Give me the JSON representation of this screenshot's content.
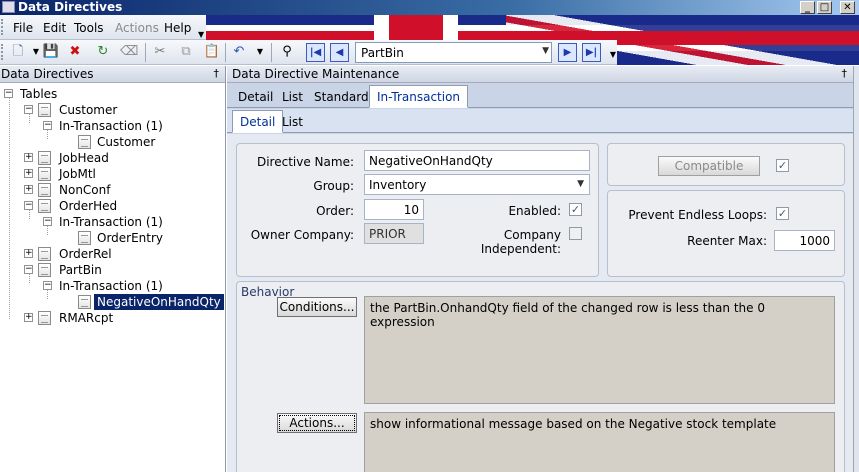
{
  "window": {
    "title": "Data Directives"
  },
  "menu": {
    "items": [
      "File",
      "Edit",
      "Tools",
      "Actions",
      "Help"
    ],
    "disabled": [
      "Actions"
    ]
  },
  "toolbar": {
    "record_combo_value": "PartBin"
  },
  "left_pane": {
    "header": "Data Directives",
    "tree": [
      {
        "label": "Tables"
      },
      {
        "label": "Customer"
      },
      {
        "label": "In-Transaction (1)"
      },
      {
        "label": "Customer"
      },
      {
        "label": "JobHead"
      },
      {
        "label": "JobMtl"
      },
      {
        "label": "NonConf"
      },
      {
        "label": "OrderHed"
      },
      {
        "label": "In-Transaction (1)"
      },
      {
        "label": "OrderEntry"
      },
      {
        "label": "OrderRel"
      },
      {
        "label": "PartBin"
      },
      {
        "label": "In-Transaction (1)"
      },
      {
        "label": "NegativeOnHandQty"
      },
      {
        "label": "RMARcpt"
      }
    ]
  },
  "right_pane": {
    "header": "Data Directive Maintenance",
    "top_tabs": [
      "Detail",
      "List",
      "Standard",
      "In-Transaction"
    ],
    "sub_tabs": [
      "Detail",
      "List"
    ]
  },
  "form": {
    "directive_name": {
      "label": "Directive Name:",
      "value": "NegativeOnHandQty"
    },
    "group": {
      "label": "Group:",
      "value": "Inventory"
    },
    "order": {
      "label": "Order:",
      "value": "10"
    },
    "enabled": {
      "label": "Enabled:",
      "checked": true
    },
    "owner_company": {
      "label": "Owner Company:",
      "value": "PRIOR"
    },
    "company_independent": {
      "label": "Company Independent:",
      "checked": false
    },
    "compatible_button": "Compatible",
    "compatible_checked": true,
    "prevent_loops": {
      "label": "Prevent Endless Loops:",
      "checked": true
    },
    "reenter_max": {
      "label": "Reenter Max:",
      "value": "1000"
    }
  },
  "behavior": {
    "title": "Behavior",
    "conditions_button": "Conditions...",
    "conditions_text": "the PartBin.OnhandQty field of the changed row is less than the 0 expression",
    "actions_button": "Actions...",
    "actions_text": "show informational message based on the Negative stock template"
  },
  "glyphs": {
    "pin": "†",
    "check": "✓",
    "min": "_",
    "max": "□",
    "close": "✕"
  }
}
